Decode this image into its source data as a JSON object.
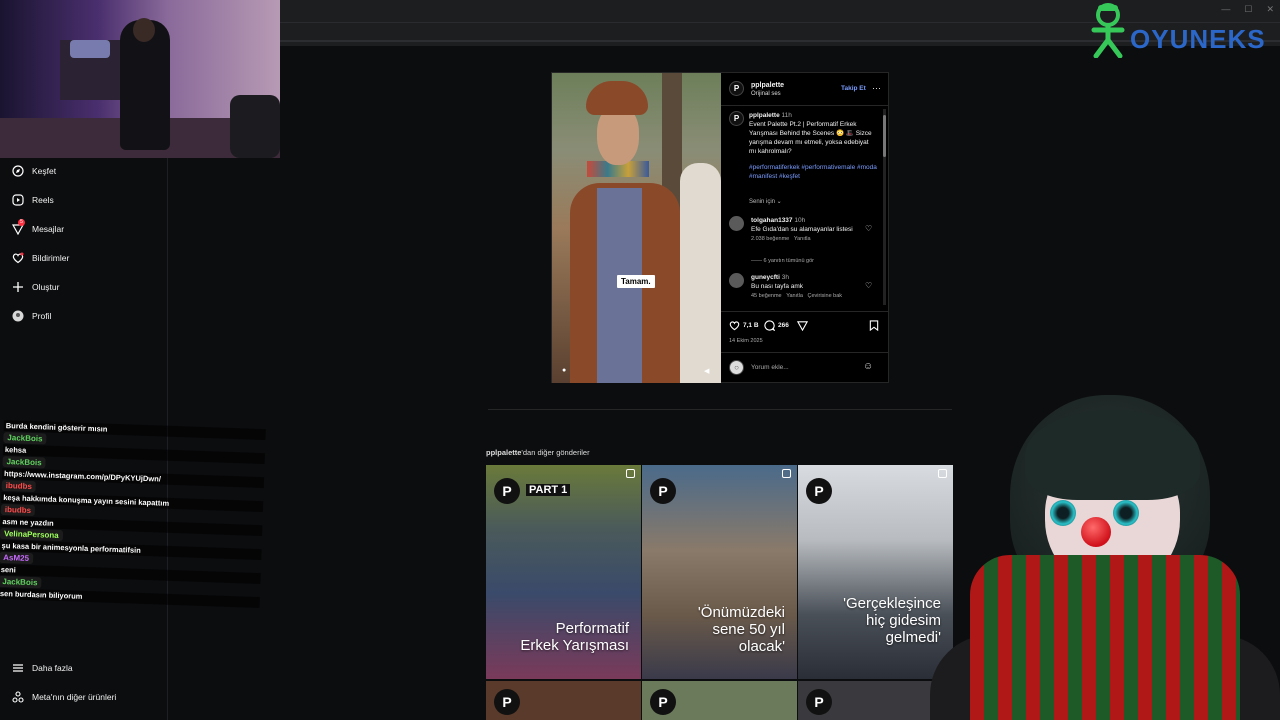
{
  "brand": {
    "name": "OYUNEKS"
  },
  "sidebar": {
    "items": [
      {
        "label": "Keşfet",
        "icon": "compass-icon"
      },
      {
        "label": "Reels",
        "icon": "reels-icon"
      },
      {
        "label": "Mesajlar",
        "icon": "messenger-icon",
        "badge": "5"
      },
      {
        "label": "Bildirimler",
        "icon": "heart-icon"
      },
      {
        "label": "Oluştur",
        "icon": "plus-icon"
      },
      {
        "label": "Profil",
        "icon": "profile-icon"
      }
    ],
    "bottom": [
      {
        "label": "Daha fazla",
        "icon": "menu-icon"
      },
      {
        "label": "Meta'nın diğer ürünleri",
        "icon": "meta-icon"
      }
    ]
  },
  "chat": [
    {
      "text": "Burda kendini gösterir mısın"
    },
    {
      "user": "JackBois",
      "color": "#5fd35f"
    },
    {
      "text": "kehsa"
    },
    {
      "user": "JackBois",
      "color": "#5fd35f"
    },
    {
      "text": "https://www.instagram.com/p/DPyKYUjDwn/"
    },
    {
      "user": "ibudbs",
      "color": "#ff4a4a"
    },
    {
      "text": "keşa hakkımda konuşma yayın sesini kapattım"
    },
    {
      "user": "ibudbs",
      "color": "#ff4a4a"
    },
    {
      "text": "asm ne yazdın"
    },
    {
      "user": "VelinaPersona",
      "color": "#9cff5a"
    },
    {
      "text": "şu kasa bir animesyonla performatifsin"
    },
    {
      "user": "AsM25",
      "color": "#c86aff"
    },
    {
      "text": "seni"
    },
    {
      "user": "JackBois",
      "color": "#5fd35f"
    },
    {
      "text": "sen burdasın biliyorum"
    }
  ],
  "post": {
    "username": "pplpalette",
    "audio": "Orijinal ses",
    "follow_label": "Takip Et",
    "caption_time": "11h",
    "caption": "Event Palette Pt.2 | Performatif Erkek Yarışması Behind the Scenes 😳 🎩 Sizce yarışma devam mı etmeli, yoksa edebiyat mı kahrolmalı?",
    "hashtags": "#performatiferkek #performativemale #moda #manifest #keşfet",
    "for_you": "Senin için",
    "media_caption": "Tamam.",
    "comments": [
      {
        "user": "tolgahan1337",
        "time": "10h",
        "text": "Efe Gıda'dan su alamayanlar listesi",
        "likes": "2.038 beğenme",
        "reply": "Yanıtla"
      },
      {
        "user": "guneycfti",
        "time": "3h",
        "text": "Bu nası tayfa amk",
        "likes": "45 beğenme",
        "reply": "Yanıtla",
        "translate": "Çevirisine bak"
      }
    ],
    "view_replies": "6 yanıtın tümünü gör",
    "likes_count": "7,1 B",
    "comments_count": "266",
    "date": "14 Ekim 2025",
    "add_comment_placeholder": "Yorum ekle..."
  },
  "more_posts": {
    "title_user": "pplpalette",
    "title_suffix": "'dan diğer gönderiler",
    "tiles": [
      {
        "tag": "PART 1",
        "title": "Performatif Erkek Yarışması"
      },
      {
        "title": "'Önümüzdeki sene 50 yıl olacak'"
      },
      {
        "title": "'Gerçekleşince hiç gidesim gelmedi'"
      }
    ]
  }
}
